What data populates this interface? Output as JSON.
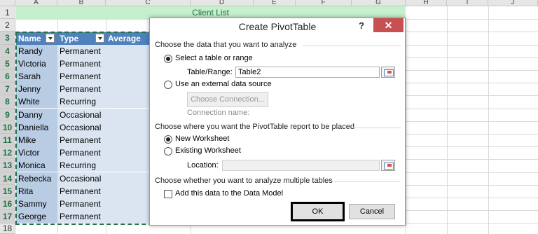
{
  "sheet": {
    "columns": [
      "A",
      "B",
      "C",
      "D",
      "E",
      "F",
      "G",
      "H",
      "I",
      "J"
    ],
    "rows": [
      "1",
      "2",
      "3",
      "4",
      "5",
      "6",
      "7",
      "8",
      "9",
      "10",
      "11",
      "12",
      "13",
      "14",
      "15",
      "16",
      "17",
      "18"
    ],
    "title": "Client List",
    "headers": [
      "Name",
      "Type",
      "Average Pu"
    ],
    "names": [
      "Randy",
      "Victoria",
      "Sarah",
      "Jenny",
      "White",
      "Danny",
      "Daniella",
      "Mike",
      "Victor",
      "Monica",
      "Rebecka",
      "Rita",
      "Sammy",
      "George"
    ],
    "types": [
      "Permanent",
      "Permanent",
      "Permanent",
      "Permanent",
      "Recurring",
      "Occasional",
      "Occasional",
      "Permanent",
      "Permanent",
      "Recurring",
      "Occasional",
      "Permanent",
      "Permanent",
      "Permanent"
    ]
  },
  "dialog": {
    "title": "Create PivotTable",
    "help": "?",
    "close": "✕",
    "section1": "Choose the data that you want to analyze",
    "select_table": "Select a table or range",
    "table_range_label": "Table/Range:",
    "table_range_value": "Table2",
    "external_source": "Use an external data source",
    "choose_connection": "Choose Connection...",
    "connection_name": "Connection name:",
    "section2": "Choose where you want the PivotTable report to be placed",
    "new_worksheet": "New Worksheet",
    "existing_worksheet": "Existing Worksheet",
    "location_label": "Location:",
    "location_value": "",
    "section3": "Choose whether you want to analyze multiple tables",
    "data_model": "Add this data to the Data Model",
    "data_model_checked": false,
    "ok": "OK",
    "cancel": "Cancel",
    "selected_option": "Select a table or range",
    "placement_option": "New Worksheet"
  }
}
